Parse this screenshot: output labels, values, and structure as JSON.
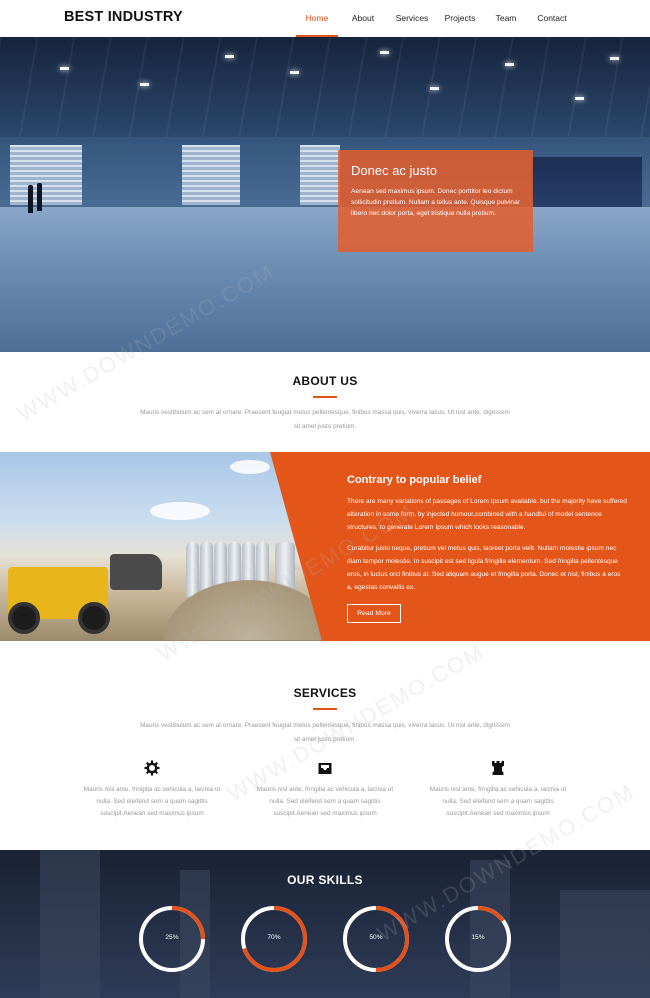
{
  "header": {
    "brand": "BEST INDUSTRY",
    "nav": [
      {
        "label": "Home",
        "active": true
      },
      {
        "label": "About",
        "active": false
      },
      {
        "label": "Services",
        "active": false
      },
      {
        "label": "Projects",
        "active": false
      },
      {
        "label": "Team",
        "active": false
      },
      {
        "label": "Contact",
        "active": false
      }
    ]
  },
  "hero": {
    "title": "Donec ac justo",
    "text": "Aenean sed maximus ipsum. Donec porttitor leo dictum sollicitudin pretium. Nullam a tellus ante. Quisque pulvinar libero nec dolor porta, eget tristique nulla pretium."
  },
  "about": {
    "title": "ABOUT US",
    "text": "Mauris vestibulum ac sem at ornare. Praesent feugiat metus pellentesque, finibus massa quis, viverra lacus. Ut nisl ante, dignissim sit amet justo pretium."
  },
  "feature": {
    "title": "Contrary to popular belief",
    "para1": "There are many variations of passages of Lorem Ipsum available, but the majority have suffered alteration in some form, by injected humour,combined with a handful of model sentence structures, to generate Lorem Ipsum which looks reasonable.",
    "para2": "Curabitur justo neque, pretium vel metus quis, laoreet porta velit. Nullam molestie ipsum nec diam tempor molestie. In suscipit est sed ligula fringilla elementum. Sed fringilla pellentesque eros, in luctus orci finibus at. Sed aliquam augue et fringilla porta. Donec et nisl, finibus a eros a, egestas convallis ex.",
    "button": "Read More"
  },
  "services": {
    "title": "SERVICES",
    "text": "Mauris vestibulum ac sem at ornare. Praesent feugiat metus pellentesque, finibus massa quis, viverra lacus. Ut nisl ante, dignissim sit amet justo pretium.",
    "items": [
      {
        "icon": "gear-icon",
        "text": "Mauris nisl ante, fringilla ac vehicula a, lacinia ut nulla. Sed eleifend sem a quam sagittis suscipit.Aenean sed maximus ipsum"
      },
      {
        "icon": "inbox-icon",
        "text": "Mauris nisl ante, fringilla ac vehicula a, lacinia ut nulla. Sed eleifend sem a quam sagittis suscipit.Aenean sed maximus ipsum"
      },
      {
        "icon": "rook-icon",
        "text": "Mauris nisl ante, fringilla ac vehicula a, lacinia ut nulla. Sed eleifend sem a quam sagittis suscipit.Aenean sed maximus ipsum"
      }
    ]
  },
  "skills": {
    "title": "OUR SKILLS",
    "items": [
      {
        "label": "25%",
        "value": 25
      },
      {
        "label": "70%",
        "value": 70
      },
      {
        "label": "50%",
        "value": 50
      },
      {
        "label": "15%",
        "value": 15
      }
    ]
  },
  "watermark": {
    "text": "WWW.DOWNDEMO.COM"
  },
  "colors": {
    "accent": "#e2521a",
    "ring_track": "#ffffff"
  }
}
